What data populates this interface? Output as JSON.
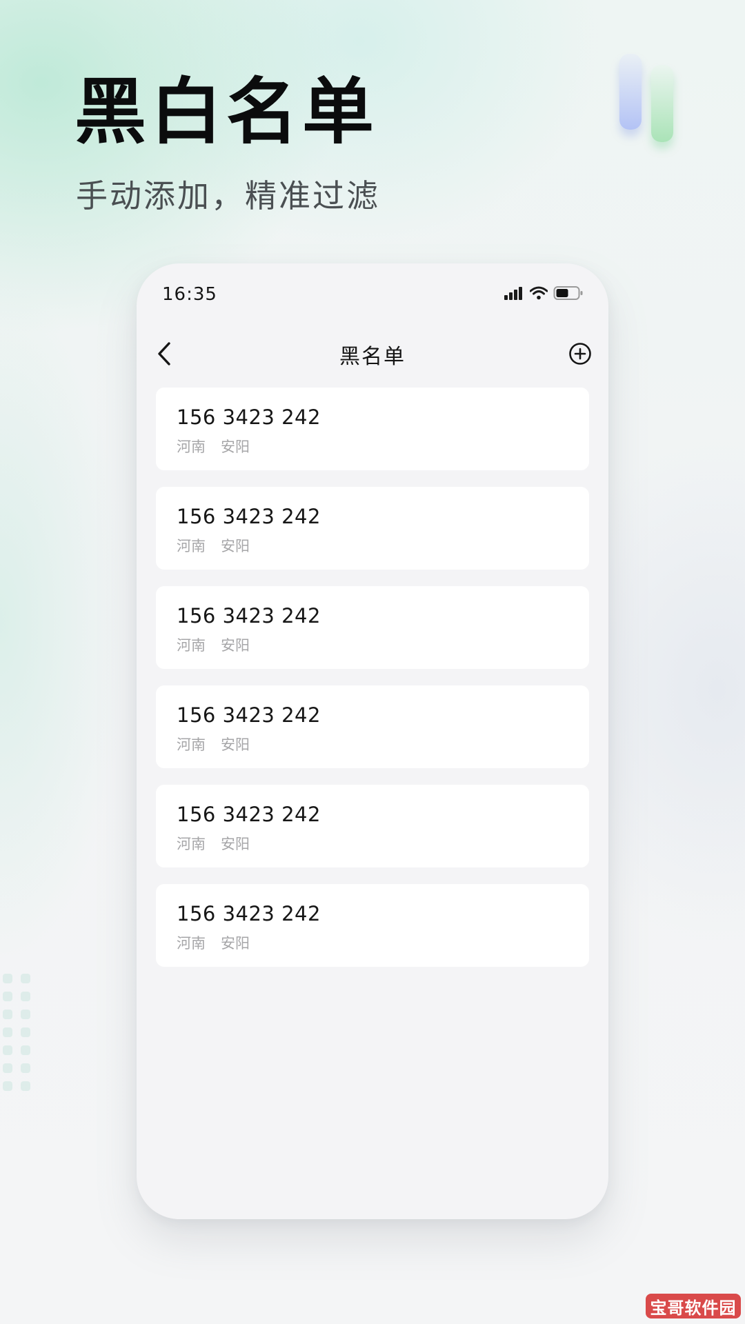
{
  "hero": {
    "title": "黑白名单",
    "subtitle": "手动添加，精准过滤"
  },
  "status_bar": {
    "time": "16:35",
    "icons": [
      "signal-icon",
      "wifi-icon",
      "battery-icon"
    ]
  },
  "nav": {
    "title": "黑名单",
    "back_icon": "chevron-left-icon",
    "add_icon": "plus-circle-icon"
  },
  "blacklist": [
    {
      "number": "156 3423 242",
      "province": "河南",
      "city": "安阳"
    },
    {
      "number": "156 3423 242",
      "province": "河南",
      "city": "安阳"
    },
    {
      "number": "156 3423 242",
      "province": "河南",
      "city": "安阳"
    },
    {
      "number": "156 3423 242",
      "province": "河南",
      "city": "安阳"
    },
    {
      "number": "156 3423 242",
      "province": "河南",
      "city": "安阳"
    },
    {
      "number": "156 3423 242",
      "province": "河南",
      "city": "安阳"
    }
  ],
  "watermark": "宝哥软件园",
  "colors": {
    "title_text": "#0b0c0d",
    "subtitle_text": "#4a4f52",
    "secondary_text": "#a6a6a8",
    "card_bg": "#ffffff",
    "phone_bg": "#f4f4f6",
    "watermark_bg": "#d94a4a"
  }
}
